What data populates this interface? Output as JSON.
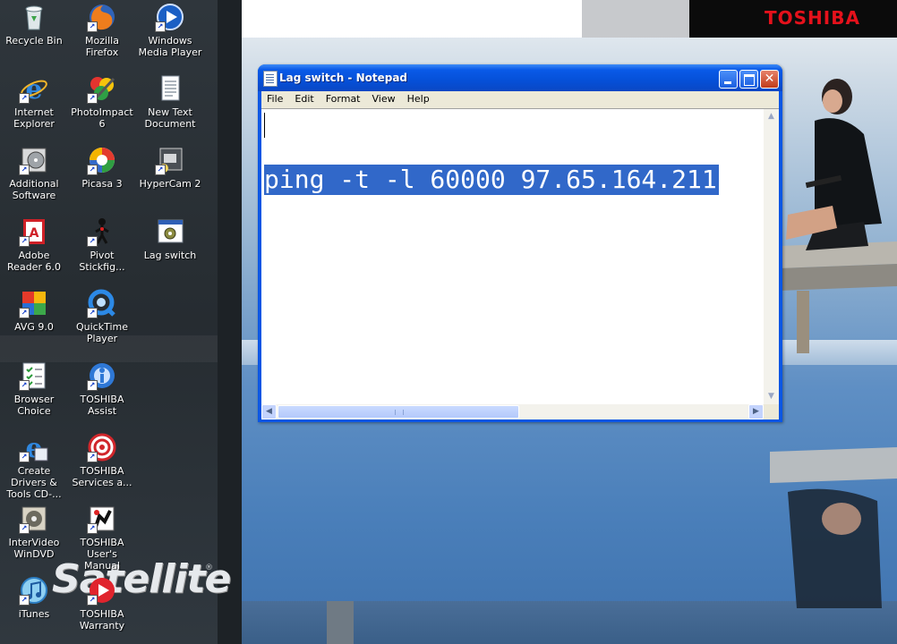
{
  "wallpaper": {
    "brand": "TOSHIBA",
    "product_logo": "Satellite",
    "registered_mark": "®"
  },
  "desktop_icons": [
    {
      "label": "Recycle Bin",
      "icon": "recycle-bin-icon"
    },
    {
      "label": "Mozilla Firefox",
      "icon": "firefox-icon"
    },
    {
      "label": "Windows Media Player",
      "icon": "media-player-icon"
    },
    {
      "label": "Internet Explorer",
      "icon": "internet-explorer-icon"
    },
    {
      "label": "PhotoImpact 6",
      "icon": "photoimpact-icon"
    },
    {
      "label": "New Text Document",
      "icon": "text-document-icon"
    },
    {
      "label": "Additional Software",
      "icon": "software-disc-icon"
    },
    {
      "label": "Picasa 3",
      "icon": "picasa-icon"
    },
    {
      "label": "HyperCam 2",
      "icon": "hypercam-icon"
    },
    {
      "label": "Adobe Reader 6.0",
      "icon": "adobe-reader-icon"
    },
    {
      "label": "Pivot Stickfig...",
      "icon": "pivot-stickfigure-icon"
    },
    {
      "label": "Lag switch",
      "icon": "batch-file-icon"
    },
    {
      "label": "AVG 9.0",
      "icon": "avg-icon"
    },
    {
      "label": "QuickTime Player",
      "icon": "quicktime-icon"
    },
    {
      "label": "Browser Choice",
      "icon": "browser-choice-icon"
    },
    {
      "label": "TOSHIBA Assist",
      "icon": "toshiba-assist-icon"
    },
    {
      "label": "Create Drivers & Tools CD-...",
      "icon": "create-drivers-icon"
    },
    {
      "label": "TOSHIBA Services a...",
      "icon": "toshiba-services-icon"
    },
    {
      "label": "InterVideo WinDVD",
      "icon": "windvd-icon"
    },
    {
      "label": "TOSHIBA User's Manual",
      "icon": "user-manual-icon"
    },
    {
      "label": "iTunes",
      "icon": "itunes-icon"
    },
    {
      "label": "TOSHIBA Warranty",
      "icon": "warranty-icon"
    }
  ],
  "notepad": {
    "title": "Lag switch - Notepad",
    "menu": [
      "File",
      "Edit",
      "Format",
      "View",
      "Help"
    ],
    "content_line_1": "",
    "content_line_2": "ping -t -l 60000 97.65.164.211",
    "close_glyph": "✕"
  }
}
